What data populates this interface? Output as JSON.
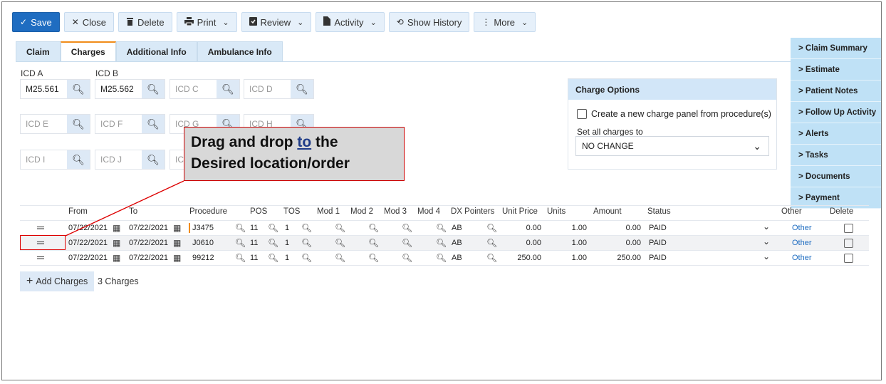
{
  "toolbar": {
    "save": "Save",
    "close": "Close",
    "delete": "Delete",
    "print": "Print",
    "review": "Review",
    "activity": "Activity",
    "show_history": "Show History",
    "more": "More"
  },
  "tabs": [
    "Claim",
    "Charges",
    "Additional Info",
    "Ambulance Info"
  ],
  "active_tab": "Charges",
  "icd": {
    "label_a": "ICD A",
    "label_b": "ICD B",
    "fields": [
      {
        "key": "A",
        "value": "M25.561",
        "placeholder": "ICD A"
      },
      {
        "key": "B",
        "value": "M25.562",
        "placeholder": "ICD B"
      },
      {
        "key": "C",
        "value": "",
        "placeholder": "ICD C"
      },
      {
        "key": "D",
        "value": "",
        "placeholder": "ICD D"
      },
      {
        "key": "E",
        "value": "",
        "placeholder": "ICD E"
      },
      {
        "key": "F",
        "value": "",
        "placeholder": "ICD F"
      },
      {
        "key": "G",
        "value": "",
        "placeholder": "ICD G"
      },
      {
        "key": "H",
        "value": "",
        "placeholder": "ICD H"
      },
      {
        "key": "I",
        "value": "",
        "placeholder": "ICD I"
      },
      {
        "key": "J",
        "value": "",
        "placeholder": "ICD J"
      },
      {
        "key": "K",
        "value": "",
        "placeholder": "ICD K"
      }
    ]
  },
  "charge_options": {
    "title": "Charge Options",
    "checkbox_label": "Create a new charge panel from procedure(s)",
    "set_all_label": "Set all charges to",
    "set_all_value": "NO CHANGE"
  },
  "right_panel": [
    "Claim Summary",
    "Estimate",
    "Patient Notes",
    "Follow Up Activity",
    "Alerts",
    "Tasks",
    "Documents",
    "Payment"
  ],
  "callout": {
    "line1_a": "Drag and drop ",
    "line1_u": "to",
    "line1_b": " the",
    "line2": "Desired location/order"
  },
  "charges_table": {
    "columns": [
      "From",
      "To",
      "Procedure",
      "POS",
      "TOS",
      "Mod 1",
      "Mod 2",
      "Mod 3",
      "Mod 4",
      "DX Pointers",
      "Unit Price",
      "Units",
      "Amount",
      "Status",
      "Other",
      "Delete"
    ],
    "rows": [
      {
        "from": "07/22/2021",
        "to": "07/22/2021",
        "procedure": "J3475",
        "pos": "11",
        "tos": "1",
        "dx": "AB",
        "unit_price": "0.00",
        "units": "1.00",
        "amount": "0.00",
        "status": "PAID",
        "other": "Other"
      },
      {
        "from": "07/22/2021",
        "to": "07/22/2021",
        "procedure": "J0610",
        "pos": "11",
        "tos": "1",
        "dx": "AB",
        "unit_price": "0.00",
        "units": "1.00",
        "amount": "0.00",
        "status": "PAID",
        "other": "Other"
      },
      {
        "from": "07/22/2021",
        "to": "07/22/2021",
        "procedure": "99212",
        "pos": "11",
        "tos": "1",
        "dx": "AB",
        "unit_price": "250.00",
        "units": "1.00",
        "amount": "250.00",
        "status": "PAID",
        "other": "Other"
      }
    ]
  },
  "add_charges": "Add Charges",
  "charges_count": "3 Charges",
  "colors": {
    "primary": "#1f6dc1",
    "tab_accent": "#f08c1a",
    "panel": "#bfe1f6",
    "callout_border": "#cc0000"
  },
  "icons": {
    "search": "magnifier-icon",
    "calendar": "calendar-icon",
    "drag": "drag-handle-icon"
  }
}
